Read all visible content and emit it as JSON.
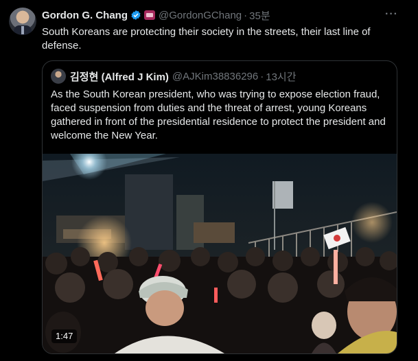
{
  "tweet": {
    "author_name": "Gordon G. Chang",
    "handle": "@GordonGChang",
    "separator": "·",
    "time": "35분",
    "more": "···",
    "text": "South Koreans are protecting their society in the streets, their last line of defense."
  },
  "quote": {
    "author_name": "김정현 (Alfred J Kim)",
    "handle": "@AJKim38836296",
    "separator": "·",
    "time": "13시간",
    "text": "As the South Korean president, who was trying to expose election fraud, faced suspension from duties and the threat of arrest, young Koreans gathered in front of the presidential residence to protect the president and welcome the New Year.",
    "video_duration": "1:47"
  },
  "colors": {
    "background": "#000000",
    "text_primary": "#e7e9ea",
    "text_secondary": "#71767b",
    "border": "#2f3336",
    "verified": "#1d9bf0"
  }
}
